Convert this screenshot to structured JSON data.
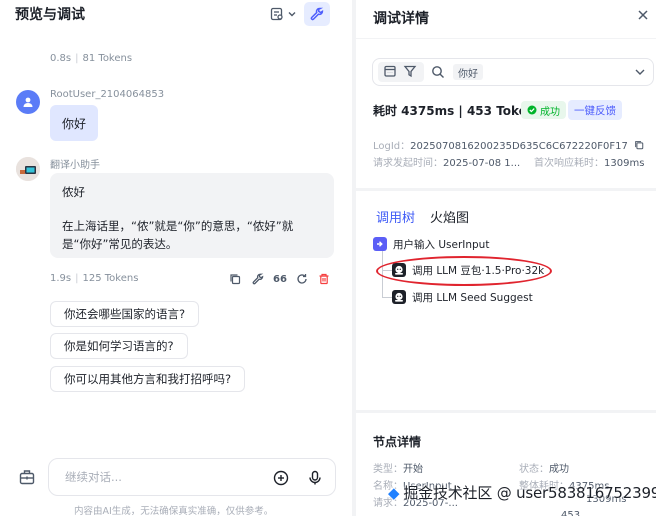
{
  "left": {
    "title": "预览与调试",
    "prev_meta": {
      "time": "0.8s",
      "tokens": "81 Tokens"
    },
    "user": {
      "name": "RootUser_2104064853",
      "message": "你好"
    },
    "bot": {
      "name": "翻译小助手",
      "line1": "侬好",
      "line2": "在上海话里，“侬”就是“你”的意思，“侬好”就是“你好”常见的表达。",
      "time": "1.9s",
      "tokens": "125 Tokens",
      "quote_label": "66"
    },
    "suggestions": [
      "你还会哪些国家的语言?",
      "你是如何学习语言的?",
      "你可以用其他方言和我打招呼吗?"
    ],
    "input_placeholder": "继续对话...",
    "disclaimer": "内容由AI生成，无法确保真实准确，仅供参考。"
  },
  "right": {
    "title": "调试详情",
    "filter_tag": "你好",
    "timing": "耗时 4375ms | 453 Tokens",
    "status": "成功",
    "feedback": "一键反馈",
    "logid_label": "LogId：",
    "logid_value": "2025070816200235D635C6C672220F0F17",
    "start_label": "请求发起时间：",
    "start_value": "2025-07-08 1...",
    "first_label": "首次响应耗时：",
    "first_value": "1309ms",
    "tabs": {
      "tree": "调用树",
      "flame": "火焰图"
    },
    "tree": [
      {
        "label": "用户输入 UserInput"
      },
      {
        "label": "调用 LLM 豆包·1.5·Pro·32k"
      },
      {
        "label": "调用 LLM Seed Suggest"
      }
    ],
    "node_details": {
      "title": "节点详情",
      "type_label": "类型：",
      "type_value": "开始",
      "state_label": "状态：",
      "state_value": "成功",
      "name_label": "名称：",
      "name_value": "UserInput",
      "total_label": "整体耗时：",
      "total_value": "4375ms",
      "req_label": "请求：",
      "req_value": "2025-07-...",
      "first_value": "1309ms",
      "extra_value": "453"
    }
  },
  "watermark": {
    "site": "掘金技术社区",
    "user": "@ user5838167523996"
  },
  "colors": {
    "accent": "#4e5efc",
    "success": "#00b42a",
    "annotation": "#e0242e"
  }
}
